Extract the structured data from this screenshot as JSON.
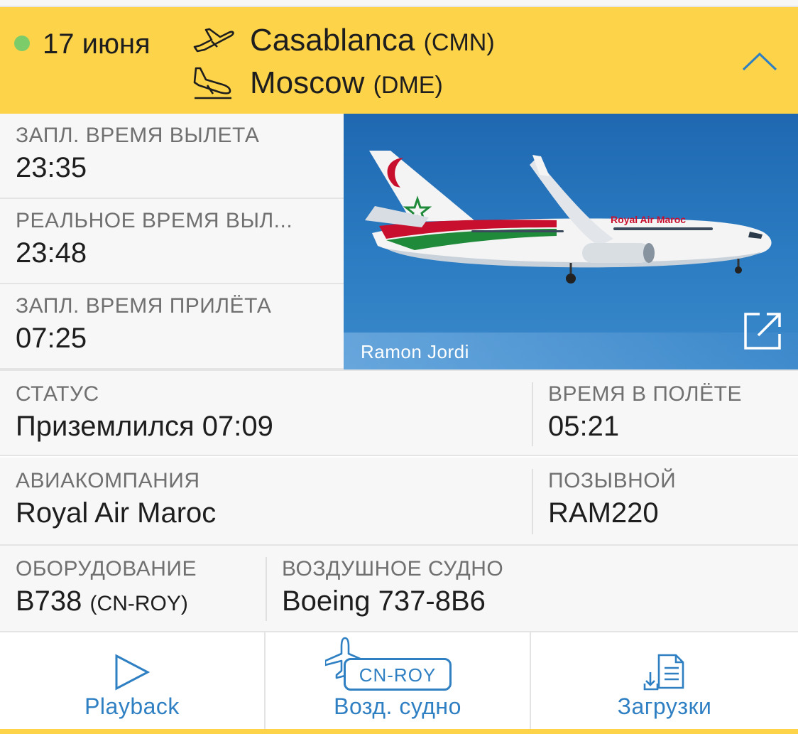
{
  "header": {
    "date": "17 июня",
    "origin_city": "Casablanca",
    "origin_code": "(CMN)",
    "destination_city": "Moscow",
    "destination_code": "(DME)",
    "status_color": "#7ccd6a",
    "background_color": "#fdd34a",
    "departure_icon": "takeoff-icon",
    "arrival_icon": "landing-icon",
    "collapse_icon": "chevron-up-icon"
  },
  "times": {
    "scheduled_departure_label": "ЗАПЛ. ВРЕМЯ ВЫЛЕТА",
    "scheduled_departure_value": "23:35",
    "actual_departure_label": "РЕАЛЬНОЕ ВРЕМЯ ВЫЛ...",
    "actual_departure_value": "23:48",
    "scheduled_arrival_label": "ЗАПЛ. ВРЕМЯ ПРИЛЁТА",
    "scheduled_arrival_value": "07:25"
  },
  "photo": {
    "credit": "Ramon Jordi",
    "livery_text": "Royal Air Maroc",
    "open_icon": "external-link-icon"
  },
  "details": {
    "status_label": "СТАТУС",
    "status_value": "Приземлился 07:09",
    "flight_time_label": "ВРЕМЯ В ПОЛЁТЕ",
    "flight_time_value": "05:21",
    "airline_label": "АВИАКОМПАНИЯ",
    "airline_value": "Royal Air Maroc",
    "callsign_label": "ПОЗЫВНОЙ",
    "callsign_value": "RAM220",
    "equipment_label": "ОБОРУДОВАНИЕ",
    "equipment_value": "B738",
    "equipment_registration": "(CN-ROY)",
    "aircraft_label": "ВОЗДУШНОЕ СУДНО",
    "aircraft_value": "Boeing 737-8B6"
  },
  "actions": {
    "accent_color": "#2f7fc3",
    "playback_label": "Playback",
    "playback_icon": "play-icon",
    "aircraft_label": "Возд. судно",
    "aircraft_badge": "CN-ROY",
    "aircraft_icon": "airplane-icon",
    "downloads_label": "Загрузки",
    "downloads_icon": "download-document-icon"
  }
}
